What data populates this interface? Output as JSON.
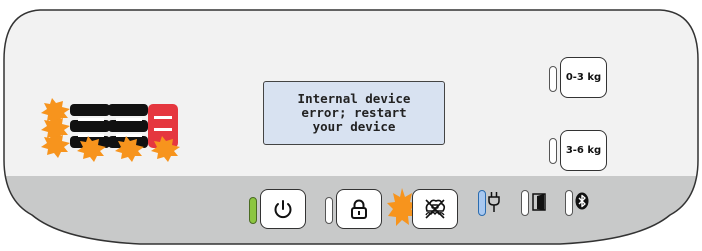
{
  "display": {
    "message": "Internal device\nerror; restart\nyour device"
  },
  "load_selector": {
    "small_label": "0-3 kg",
    "large_label": "3-6 kg",
    "small_indicator_on": false,
    "large_indicator_on": false
  },
  "controls": {
    "power_indicator": "on",
    "lock_indicator": "off",
    "diagnostic_warning": "active"
  },
  "status_icons": {
    "plug_indicator": "on",
    "door_indicator": "off",
    "bluetooth_indicator": "off"
  },
  "colors": {
    "panel_top": "#f2f2f2",
    "panel_bottom": "#c8c9c9",
    "lcd_bg": "#d8e2f1",
    "power_led": "#8cc640",
    "plug_led": "#a8c8f0",
    "warning_burst": "#f7941d",
    "segment_dark": "#111111",
    "segment_red": "#e5373f"
  },
  "icons": {
    "power": "power-icon",
    "lock": "lock-icon",
    "diagnostic": "stain-alert-icon",
    "plug": "plug-icon",
    "door": "door-icon",
    "bluetooth": "bluetooth-icon"
  }
}
